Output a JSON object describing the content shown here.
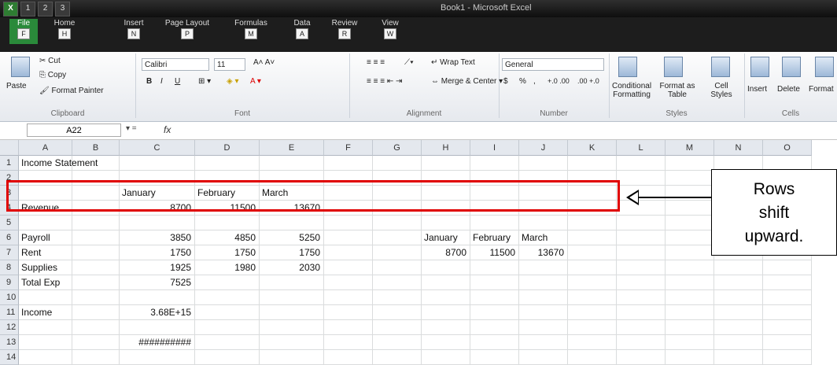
{
  "window": {
    "title": "Book1 - Microsoft Excel"
  },
  "qat": {
    "one": "1",
    "two": "2",
    "three": "3"
  },
  "tabs": [
    {
      "label": "File",
      "key": "F"
    },
    {
      "label": "Home",
      "key": "H"
    },
    {
      "label": "Insert",
      "key": "N"
    },
    {
      "label": "Page Layout",
      "key": "P"
    },
    {
      "label": "Formulas",
      "key": "M"
    },
    {
      "label": "Data",
      "key": "A"
    },
    {
      "label": "Review",
      "key": "R"
    },
    {
      "label": "View",
      "key": "W"
    }
  ],
  "ribbon": {
    "clipboard": {
      "paste": "Paste",
      "cut": "Cut",
      "copy": "Copy",
      "format_painter": "Format Painter",
      "label": "Clipboard"
    },
    "font": {
      "name": "Calibri",
      "size": "11",
      "bold": "B",
      "italic": "I",
      "underline": "U",
      "label": "Font"
    },
    "alignment": {
      "wrap": "Wrap Text",
      "merge": "Merge & Center",
      "label": "Alignment"
    },
    "number": {
      "format": "General",
      "currency": "$",
      "percent": "%",
      "comma": ",",
      "inc": "+.0 .00",
      "dec": ".00 +.0",
      "label": "Number"
    },
    "styles": {
      "conditional": "Conditional Formatting",
      "format_table": "Format as Table",
      "cell_styles": "Cell Styles",
      "label": "Styles"
    },
    "cells": {
      "insert": "Insert",
      "delete": "Delete",
      "format": "Format",
      "label": "Cells"
    }
  },
  "formula_bar": {
    "name_box": "A22",
    "fx": "fx",
    "value": ""
  },
  "columns": [
    "A",
    "B",
    "C",
    "D",
    "E",
    "F",
    "G",
    "H",
    "I",
    "J",
    "K",
    "L",
    "M",
    "N",
    "O"
  ],
  "rows": [
    {
      "n": "1",
      "cells": {
        "A": "Income Statement"
      }
    },
    {
      "n": "2",
      "cells": {}
    },
    {
      "n": "3",
      "cells": {
        "C": "January",
        "D": "February",
        "E": "March"
      }
    },
    {
      "n": "4",
      "cells": {
        "A": "Revenue",
        "C": "8700",
        "D": "11500",
        "E": "13670"
      }
    },
    {
      "n": "5",
      "cells": {}
    },
    {
      "n": "6",
      "cells": {
        "A": "Payroll",
        "C": "3850",
        "D": "4850",
        "E": "5250",
        "H": "January",
        "I": "February",
        "J": "March"
      }
    },
    {
      "n": "7",
      "cells": {
        "A": "Rent",
        "C": "1750",
        "D": "1750",
        "E": "1750",
        "H": "8700",
        "I": "11500",
        "J": "13670"
      }
    },
    {
      "n": "8",
      "cells": {
        "A": "Supplies",
        "C": "1925",
        "D": "1980",
        "E": "2030"
      }
    },
    {
      "n": "9",
      "cells": {
        "A": "Total Exp",
        "C": "7525"
      }
    },
    {
      "n": "10",
      "cells": {}
    },
    {
      "n": "11",
      "cells": {
        "A": "Income",
        "C": "3.68E+15"
      }
    },
    {
      "n": "12",
      "cells": {}
    },
    {
      "n": "13",
      "cells": {
        "C": "##########"
      }
    },
    {
      "n": "14",
      "cells": {}
    }
  ],
  "annotation": {
    "line1": "Rows",
    "line2": "shift",
    "line3": "upward."
  },
  "colors": {
    "highlight": "#e00000",
    "file_tab": "#2a8a3a"
  }
}
